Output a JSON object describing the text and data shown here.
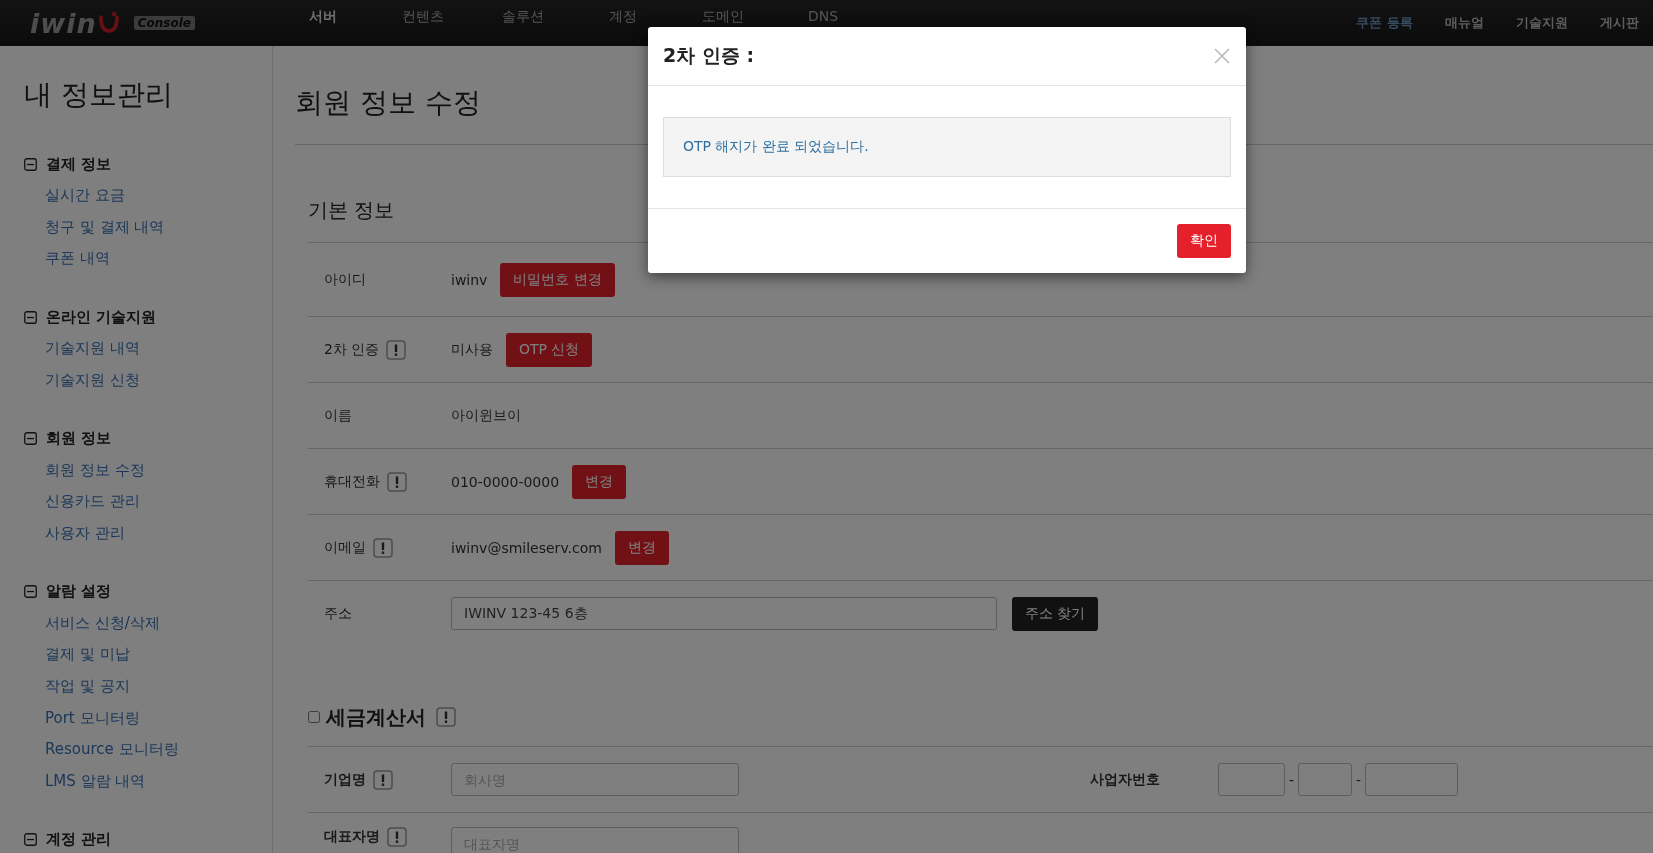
{
  "header": {
    "logo": "iwin",
    "badge": "Console",
    "nav": [
      {
        "label": "서버",
        "selected": true
      },
      {
        "label": "컨텐츠",
        "selected": false
      },
      {
        "label": "솔루션",
        "selected": false
      },
      {
        "label": "계정",
        "selected": false
      },
      {
        "label": "도메인",
        "selected": false
      },
      {
        "label": "DNS",
        "selected": false
      }
    ],
    "links": [
      {
        "label": "쿠폰 등록",
        "kind": "highlight"
      },
      {
        "label": "매뉴얼",
        "kind": "plain"
      },
      {
        "label": "기술지원",
        "kind": "plain"
      },
      {
        "label": "게시판",
        "kind": "plain"
      }
    ]
  },
  "sidebar": {
    "title": "내 정보관리",
    "groups": [
      {
        "label": "결제 정보",
        "expanded": true,
        "items": [
          "실시간 요금",
          "청구 및 결제 내역",
          "쿠폰 내역"
        ]
      },
      {
        "label": "온라인 기술지원",
        "expanded": true,
        "items": [
          "기술지원 내역",
          "기술지원 신청"
        ]
      },
      {
        "label": "회원 정보",
        "expanded": true,
        "items": [
          "회원 정보 수정",
          "신용카드 관리",
          "사용자 관리"
        ]
      },
      {
        "label": "알람 설정",
        "expanded": true,
        "items": [
          "서비스 신청/삭제",
          "결제 및 미납",
          "작업 및 공지",
          "Port 모니터링",
          "Resource 모니터링",
          "LMS 알람 내역"
        ]
      },
      {
        "label": "계정 관리",
        "expanded": true
      }
    ]
  },
  "page_title": "회원 정보 수정",
  "basic": {
    "title": "기본 정보",
    "rows": [
      {
        "label": "아이디",
        "info": false,
        "kind": "text",
        "value": "iwinv",
        "button": "비밀번호 변경"
      },
      {
        "label": "2차 인증",
        "info": true,
        "kind": "text",
        "value": "미사용",
        "button": "OTP 신청"
      },
      {
        "label": "이름",
        "info": false,
        "kind": "text",
        "value": "아이윈브이"
      },
      {
        "label": "휴대전화",
        "info": true,
        "kind": "text",
        "value": "010-0000-0000",
        "button": "변경"
      },
      {
        "label": "이메일",
        "info": true,
        "kind": "text",
        "value": "iwinv@smileserv.com",
        "button": "변경"
      },
      {
        "label": "주소",
        "info": false,
        "kind": "field",
        "value": "IWINV 123-45 6층",
        "button": "주소 찾기"
      }
    ]
  },
  "tax": {
    "title": "세금계산서",
    "checked": false,
    "info": true,
    "company": {
      "label": "기업명",
      "info": true,
      "placeholder": "회사명"
    },
    "business_number": {
      "label": "사업자번호",
      "separators": [
        "-",
        "-"
      ]
    },
    "ceo": {
      "label": "대표자명",
      "info": true,
      "placeholder": "대표자명"
    }
  },
  "modal": {
    "title": "2차 인증 :",
    "message": "OTP 해지가 완료 되었습니다.",
    "button": "확인"
  }
}
